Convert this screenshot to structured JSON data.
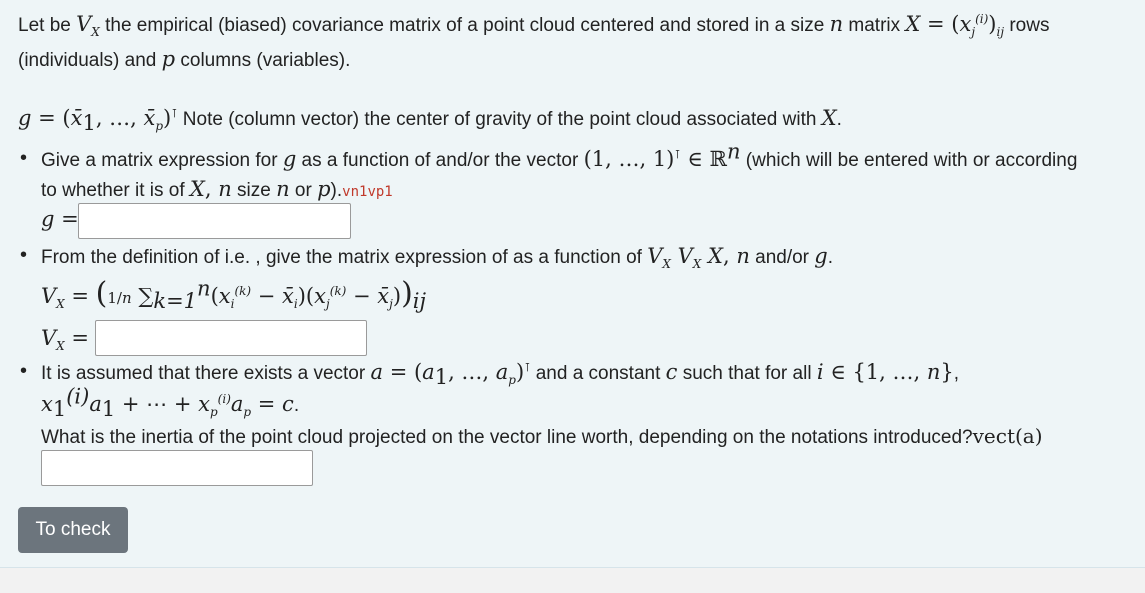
{
  "intro": {
    "line1_a": "Let be ",
    "line1_b": " the empirical (biased) covariance matrix of a point cloud centered and stored in a size ",
    "line1_c": " matrix ",
    "line1_d": " rows",
    "line2": "(individuals) and ",
    "line2_b": " columns (variables)."
  },
  "gravity": {
    "text": " Note (column vector) the center of gravity of the point cloud associated with "
  },
  "q1": {
    "text_a": "Give a matrix expression for ",
    "text_b": " as a function of and/or the vector ",
    "text_c": " (which will be entered with or according",
    "text_d": "to whether it is of ",
    "text_e": " size ",
    "text_f": " or ",
    "code": "vn1vp1",
    "label": "g ="
  },
  "q2": {
    "text_a": "From the definition of i.e. , give the matrix expression of as a function of ",
    "text_b": " and/or ",
    "label": "Vx ="
  },
  "q3": {
    "text_a": "It is assumed that there exists a vector ",
    "text_b": " and a constant ",
    "text_c": " such that for all ",
    "question": "What is the inertia of the point cloud projected on the vector line worth, depending on the notations introduced?",
    "vect": "vect(a)"
  },
  "buttons": {
    "check": "To check"
  }
}
